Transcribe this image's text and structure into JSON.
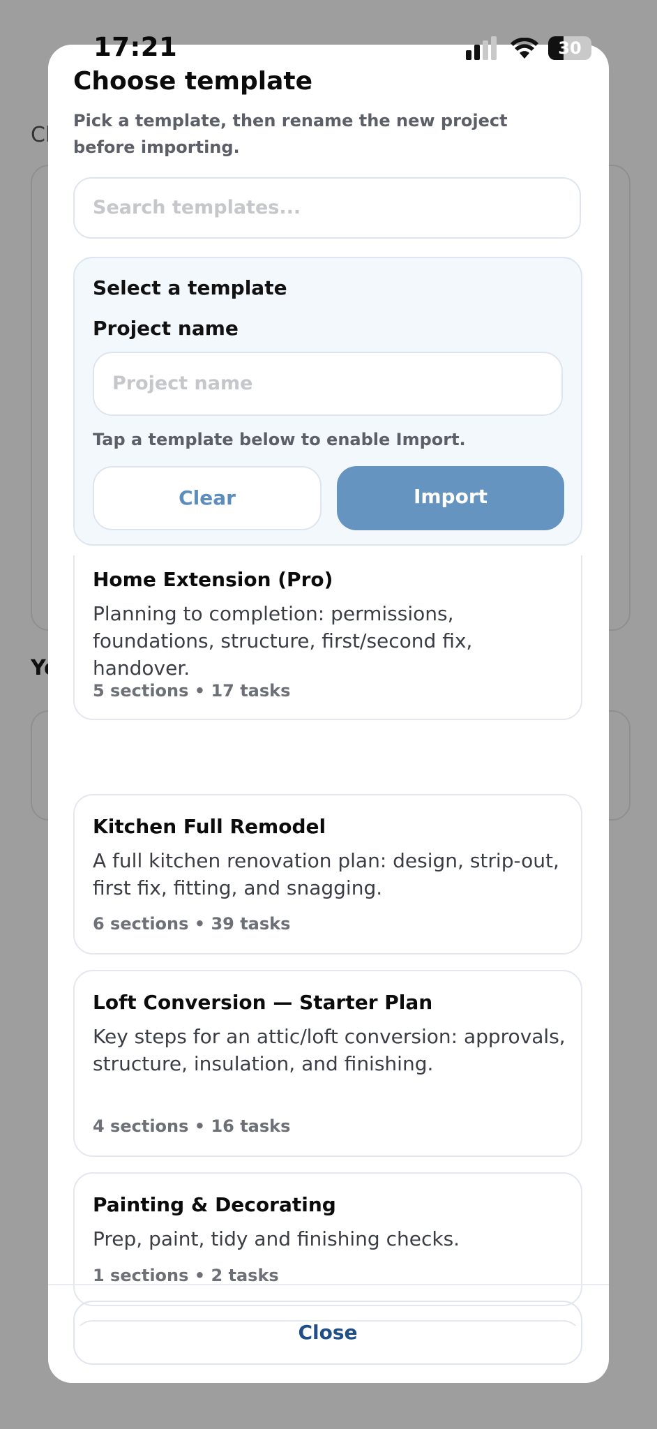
{
  "status_bar": {
    "time": "17:21",
    "battery": "30"
  },
  "background": {
    "fragment_1": "Cl",
    "fragment_2": "Yo"
  },
  "sheet": {
    "title": "Choose template",
    "subtitle": "Pick a template, then rename the new project before importing.",
    "search_placeholder": "Search templates...",
    "panel": {
      "heading": "Select a template",
      "project_name_label": "Project name",
      "project_name_placeholder": "Project name",
      "hint": "Tap a template below to enable Import.",
      "clear_label": "Clear",
      "import_label": "Import"
    },
    "templates": [
      {
        "title": "Home Extension (Pro)",
        "description": "Planning to completion: permissions, foundations, structure, first/second fix, handover.",
        "meta": "5 sections • 17 tasks"
      },
      {
        "title": "Kitchen Full Remodel",
        "description": "A full kitchen renovation plan: design, strip-out, first fix, fitting, and snagging.",
        "meta": "6 sections • 39 tasks"
      },
      {
        "title": "Loft Conversion — Starter Plan",
        "description": "Key steps for an attic/loft conversion: approvals, structure, insulation, and finishing.",
        "meta": "4 sections • 16 tasks"
      },
      {
        "title": "Painting & Decorating",
        "description": "Prep, paint, tidy and finishing checks.",
        "meta": "1 sections • 2 tasks"
      }
    ],
    "close_label": "Close"
  }
}
